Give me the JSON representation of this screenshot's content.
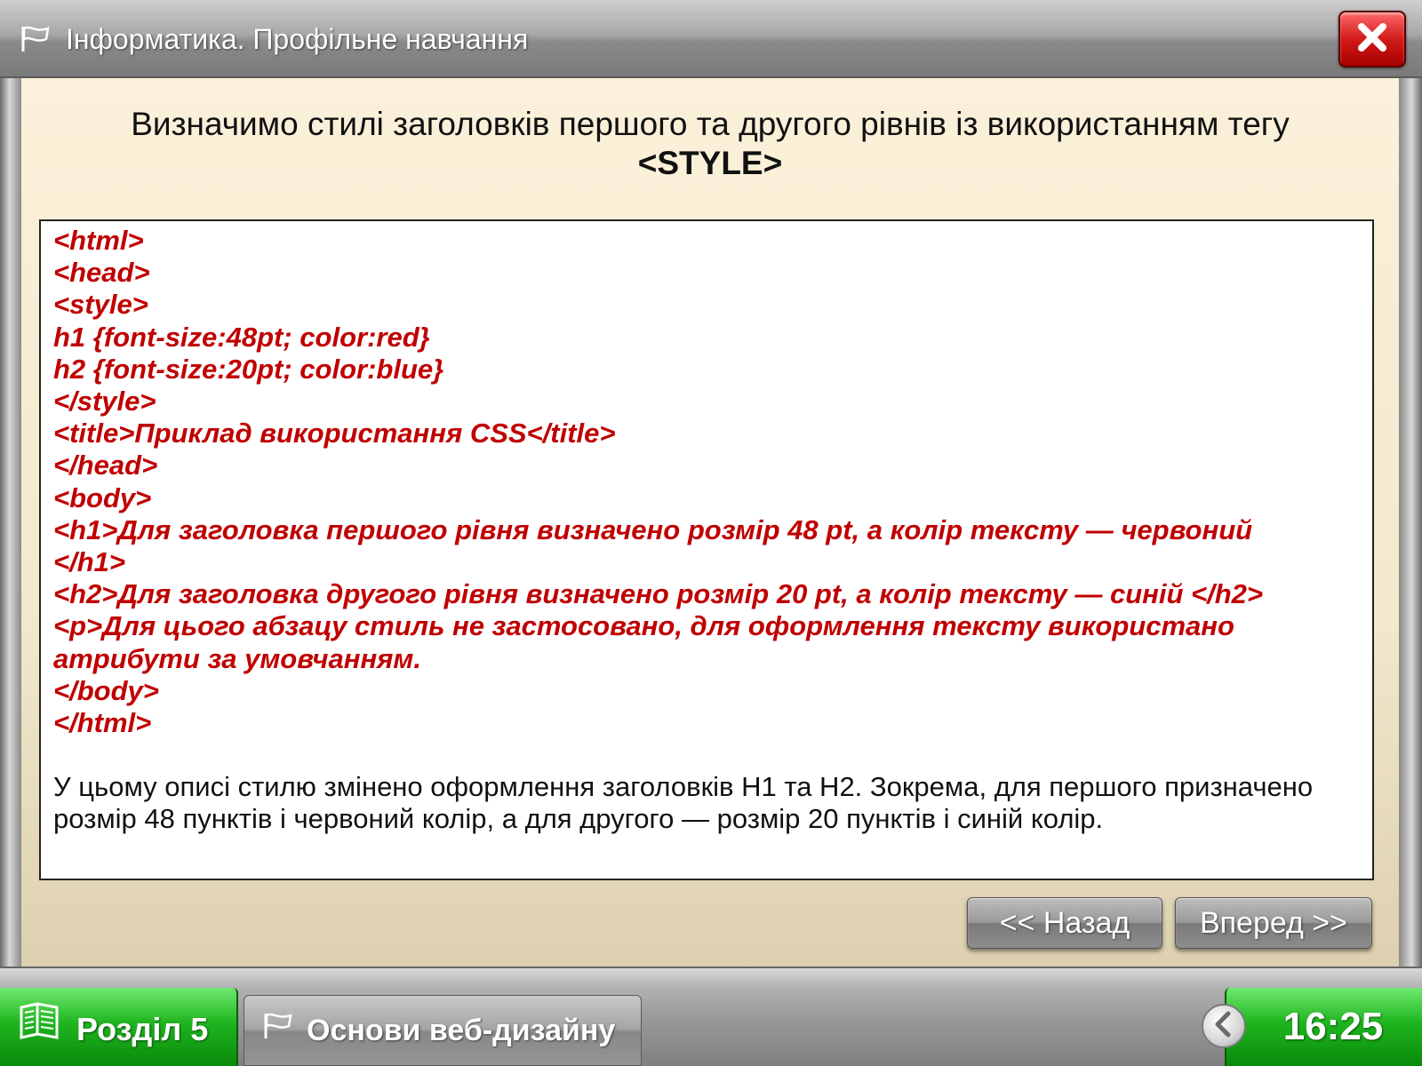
{
  "window": {
    "title": "Інформатика. Профільне навчання"
  },
  "heading": {
    "line1": "Визначимо стилі заголовків першого та другого рівнів із використанням тегу",
    "tag": "<STYLE>"
  },
  "code_lines": [
    "<html>",
    "<head>",
    "<style>",
    "h1 {font-size:48pt; color:red}",
    "h2 {font-size:20pt; color:blue}",
    "</style>",
    "<title>Приклад використання CSS</title>",
    "</head>",
    "<body>",
    "<h1>Для заголовка першого рівня визначено розмір 48 pt, а колір тексту — червоний",
    "</h1>",
    "<h2>Для заголовка другого рівня визначено розмір 20 pt, а колір тексту — синій </h2>",
    "<p>Для цього абзацу стиль не застосовано, для оформлення тексту використано",
    "атрибути за умовчанням.",
    "</body>",
    "</html>"
  ],
  "explanation": "У цьому описі стилю змінено оформлення заголовків H1 та H2. Зокрема, для першого призначено розмір 48 пунктів і червоний колір, а для другого — розмір 20 пунктів і синій колір.",
  "nav": {
    "back_label": "<< Назад",
    "forward_label": "Вперед >>"
  },
  "taskbar": {
    "section_label": "Розділ 5",
    "topic_label": "Основи веб-дизайну",
    "time": "16:25"
  },
  "colors": {
    "code_text": "#c00000",
    "content_bg": "#f4e8cd",
    "accent_green": "#1fb51f",
    "close_red": "#d21a1a"
  },
  "icons": {
    "title": "flag-icon",
    "close": "close-icon",
    "section": "book-icon",
    "topic": "flag-icon",
    "collapse": "chevron-left-icon"
  }
}
